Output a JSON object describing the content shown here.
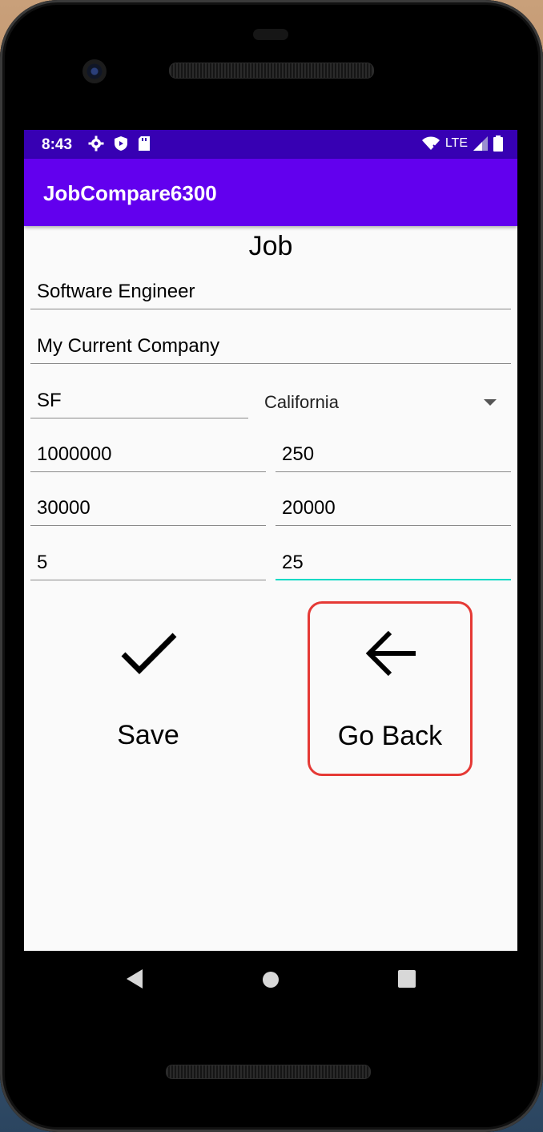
{
  "status_bar": {
    "time": "8:43",
    "network": "LTE",
    "icons_left": [
      "gear-icon",
      "shield-icon",
      "sd-card-icon"
    ],
    "icons_right": [
      "wifi-icon",
      "signal-icon",
      "battery-icon"
    ]
  },
  "app_bar": {
    "title": "JobCompare6300"
  },
  "form": {
    "heading": "Job",
    "title_value": "Software Engineer",
    "company_value": "My Current Company",
    "city_value": "SF",
    "state_selected": "California",
    "row1": {
      "left": "1000000",
      "right": "250"
    },
    "row2": {
      "left": "30000",
      "right": "20000"
    },
    "row3": {
      "left": "5",
      "right": "25"
    }
  },
  "actions": {
    "save_label": "Save",
    "back_label": "Go Back"
  },
  "colors": {
    "status_bar": "#3700b3",
    "app_bar": "#6200ee",
    "focus_underline": "#03dac5",
    "highlight_border": "#e53935"
  }
}
